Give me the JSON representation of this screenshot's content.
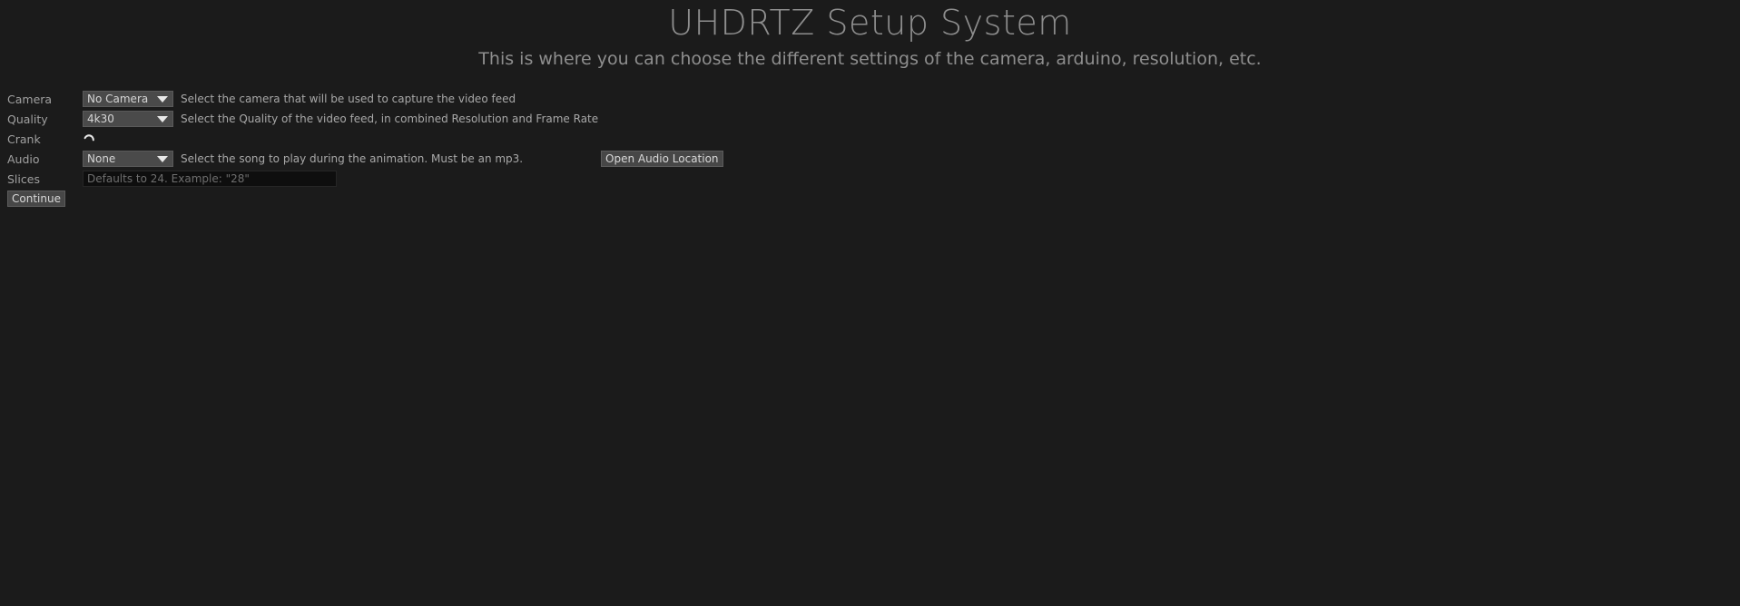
{
  "header": {
    "title": "UHDRTZ Setup System",
    "subtitle": "This is where you can choose the different settings of the camera, arduino, resolution, etc."
  },
  "rows": {
    "camera": {
      "label": "Camera",
      "selected": "No Camera",
      "hint": "Select the camera that will be used to capture the video feed"
    },
    "quality": {
      "label": "Quality",
      "selected": "4k30",
      "hint": "Select the Quality of the video feed, in combined Resolution and Frame Rate"
    },
    "crank": {
      "label": "Crank",
      "icon": "loading-spinner-icon"
    },
    "audio": {
      "label": "Audio",
      "selected": "None",
      "hint": "Select the song to play during the animation. Must be an mp3.",
      "open_button": "Open Audio Location"
    },
    "slices": {
      "label": "Slices",
      "value": "",
      "placeholder": "Defaults to 24. Example: \"28\""
    }
  },
  "actions": {
    "continue_label": "Continue"
  },
  "colors": {
    "background": "#1b1b1b",
    "control": "#4a4a4a",
    "input_background": "#0e0e0e",
    "text": "#a8a8a8"
  }
}
